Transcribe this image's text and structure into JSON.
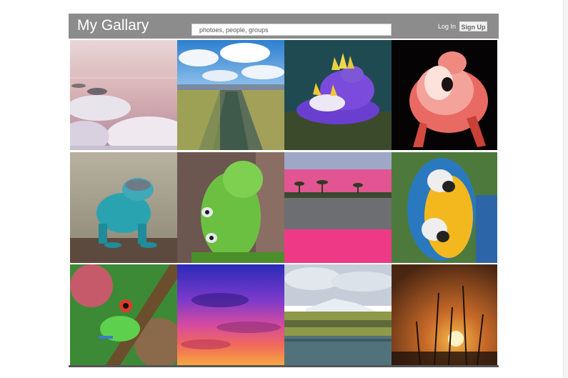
{
  "header": {
    "title": "My Gallary",
    "search_placeholder": "photoes, people, groups",
    "login_label": "Log In",
    "signup_label": "Sign Up"
  },
  "photos": [
    {
      "subject": "salt flat lake"
    },
    {
      "subject": "grassland stream"
    },
    {
      "subject": "purple nudibranch"
    },
    {
      "subject": "pink flamingo"
    },
    {
      "subject": "blue lizard"
    },
    {
      "subject": "green caterpillar"
    },
    {
      "subject": "pink sand oasis"
    },
    {
      "subject": "blue and yellow macaws"
    },
    {
      "subject": "red-eyed tree frog"
    },
    {
      "subject": "purple sunset sky"
    },
    {
      "subject": "mountain lake landscape"
    },
    {
      "subject": "sunset silhouette plants"
    }
  ]
}
